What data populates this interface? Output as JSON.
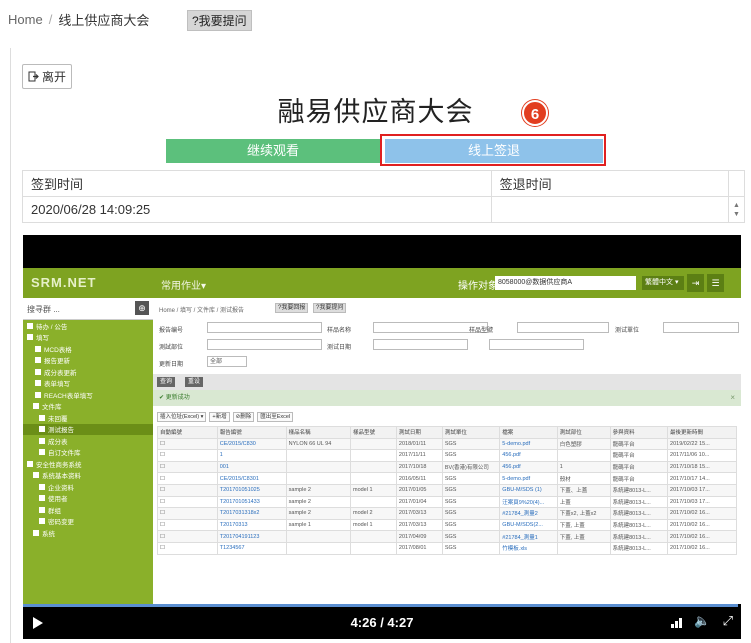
{
  "breadcrumb": {
    "home": "Home",
    "separator": "/",
    "current": "线上供应商大会"
  },
  "ask_button": "?我要提问",
  "leave_button": {
    "icon": "exit-icon",
    "label": "离开"
  },
  "page_title": "融易供应商大会",
  "step_badge": "6",
  "buttons": {
    "continue_watching": "继续观看",
    "online_signout": "线上签退"
  },
  "colors": {
    "continue": "#5cc07c",
    "signout": "#8ec2ea",
    "highlight": "#e02020",
    "badge": "#e23d1f"
  },
  "time_table": {
    "headers": [
      "签到时间",
      "签退时间"
    ],
    "rows": [
      [
        "2020/06/28 14:09:25",
        ""
      ]
    ]
  },
  "video": {
    "time": "4:26 / 4:27",
    "progress": 0.996,
    "icons": [
      "play-icon",
      "quality-icon",
      "volume-icon",
      "fullscreen-icon"
    ],
    "screen": {
      "logo": "SRM.NET",
      "menu": "常用作业▾",
      "target_label": "操作对象",
      "target_value": "8058000@数据供应商A",
      "lang": "繁體中文 ▾",
      "side_search": "搜寻群 ...",
      "nav": [
        "待办 / 公告",
        "填写",
        "MCD表格",
        "报告更新",
        "成分表更新",
        "表单填写",
        "REACH表单填写",
        "文件库",
        "未回覆",
        "测试报告",
        "成分表",
        "自订文件库",
        "安全性商务系统",
        "系统基本资料",
        "企业资料",
        "使用者",
        "群组",
        "密码变更",
        "系统"
      ],
      "breadcrumb": "Home / 填写 / 文件库 / 测试报告",
      "tags": [
        "?我要回报",
        "?我要提问"
      ],
      "form_labels": [
        "报告编号",
        "样品名称",
        "样品型號",
        "测试單位",
        "測試部位",
        "测试日期",
        "更新日期"
      ],
      "form_select": "全部",
      "bar_buttons": [
        "查询",
        "重设"
      ],
      "success": "✔ 更新成功",
      "toolbar": [
        "插入位址(Excel) ▾",
        "+新增",
        "⊘删除",
        "匯出至Excel"
      ],
      "grid_headers": [
        "自動編號",
        "報告編號",
        "樣品名稱",
        "樣品型號",
        "測試日期",
        "測試單位",
        "檔案",
        "測試部位",
        "參與資料",
        "最後更新時間"
      ],
      "grid_rows": [
        [
          "CE/2015/C830",
          "NYLON 66 UL 94",
          "",
          "2018/01/11",
          "SGS",
          "5-demo.pdf",
          "白色塑膠",
          "龍碼平台",
          "2019/02/22 15..."
        ],
        [
          "1",
          "",
          "",
          "2017/11/11",
          "SGS",
          "456.pdf",
          "",
          "龍碼平台",
          "2017/11/06 10..."
        ],
        [
          "001",
          "",
          "",
          "2017/10/18",
          "BV(香港)有限公司",
          "456.pdf",
          "1",
          "龍碼平台",
          "2017/10/18 15..."
        ],
        [
          "CE/2015/C8301",
          "",
          "",
          "2016/05/11",
          "SGS",
          "5-demo.pdf",
          "殼材",
          "龍碼平台",
          "2017/10/17 14..."
        ],
        [
          "T201701051025",
          "sample 2",
          "model 1",
          "2017/01/05",
          "SGS",
          "GBU-M/SDS (1)",
          "下蓋、上蓋",
          "系統建8013-L...",
          "2017/10/03 17..."
        ],
        [
          "T201701051433",
          "sample 2",
          "",
          "2017/01/04",
          "SGS",
          "汪案頁9%20(4)...",
          "上蓋",
          "系統建8013-L...",
          "2017/10/03 17..."
        ],
        [
          "T2017031318x2",
          "sample 2",
          "model 2",
          "2017/03/13",
          "SGS",
          "#21784_測量2",
          "下蓋x2, 上蓋x2",
          "系統建8013-L...",
          "2017/10/02 16..."
        ],
        [
          "T20170313",
          "sample 1",
          "model 1",
          "2017/03/13",
          "SGS",
          "GBU-M/SDS(2...",
          "下蓋, 上蓋",
          "系統建8013-L...",
          "2017/10/02 16..."
        ],
        [
          "T201704191123",
          "",
          "",
          "2017/04/09",
          "SGS",
          "#21784_測量1",
          "下蓋, 上蓋",
          "系統建8013-L...",
          "2017/10/02 16..."
        ],
        [
          "T1234567",
          "",
          "",
          "2017/08/01",
          "SGS",
          "竹模板.xls",
          "",
          "系統建8013-L...",
          "2017/10/02 16..."
        ]
      ]
    }
  }
}
